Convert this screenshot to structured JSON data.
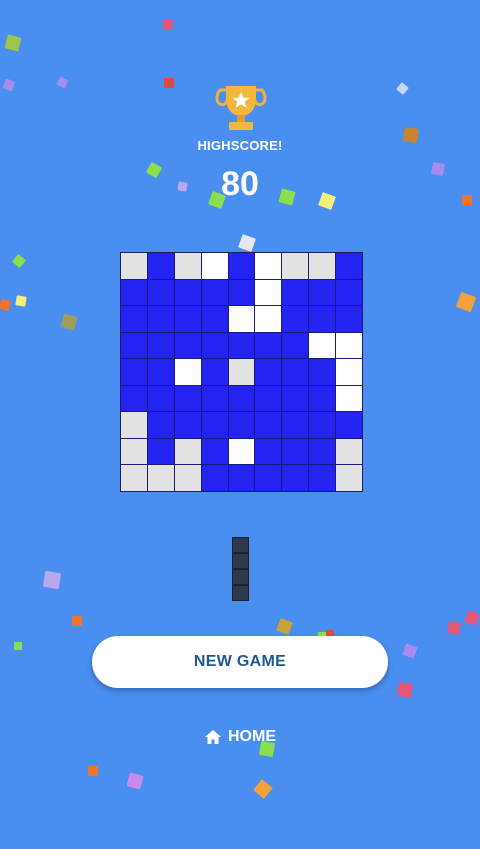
{
  "header": {
    "trophy_icon": "trophy-icon",
    "highscore_label": "HIGHSCORE!",
    "score": "80"
  },
  "board": {
    "rows": 9,
    "cols": 9,
    "legend": {
      "F": "filled-blue",
      "E": "empty-grey",
      "W": "cleared-white"
    },
    "grid": [
      "EFEWFWEEF",
      "FFFFFWFFF",
      "FFFFWWFFF",
      "FFFFFFFWW",
      "FFWFEFFFW",
      "FFFFFFFFW",
      "EFFFFFFFF",
      "EFEFWFFFE",
      "EEEFFFFFE"
    ]
  },
  "next_piece": {
    "orientation": "vertical",
    "length": 4
  },
  "actions": {
    "new_game_label": "NEW GAME",
    "home_label": "HOME",
    "home_icon": "home-icon"
  },
  "colors": {
    "background": "#4a8ef0",
    "filled_cell": "#2424f2",
    "empty_cell": "#e2e2e2",
    "cleared_cell": "#ffffff",
    "trophy": "#f0b43a",
    "button_text": "#1d5a8f",
    "piece": "#2e3a49"
  }
}
